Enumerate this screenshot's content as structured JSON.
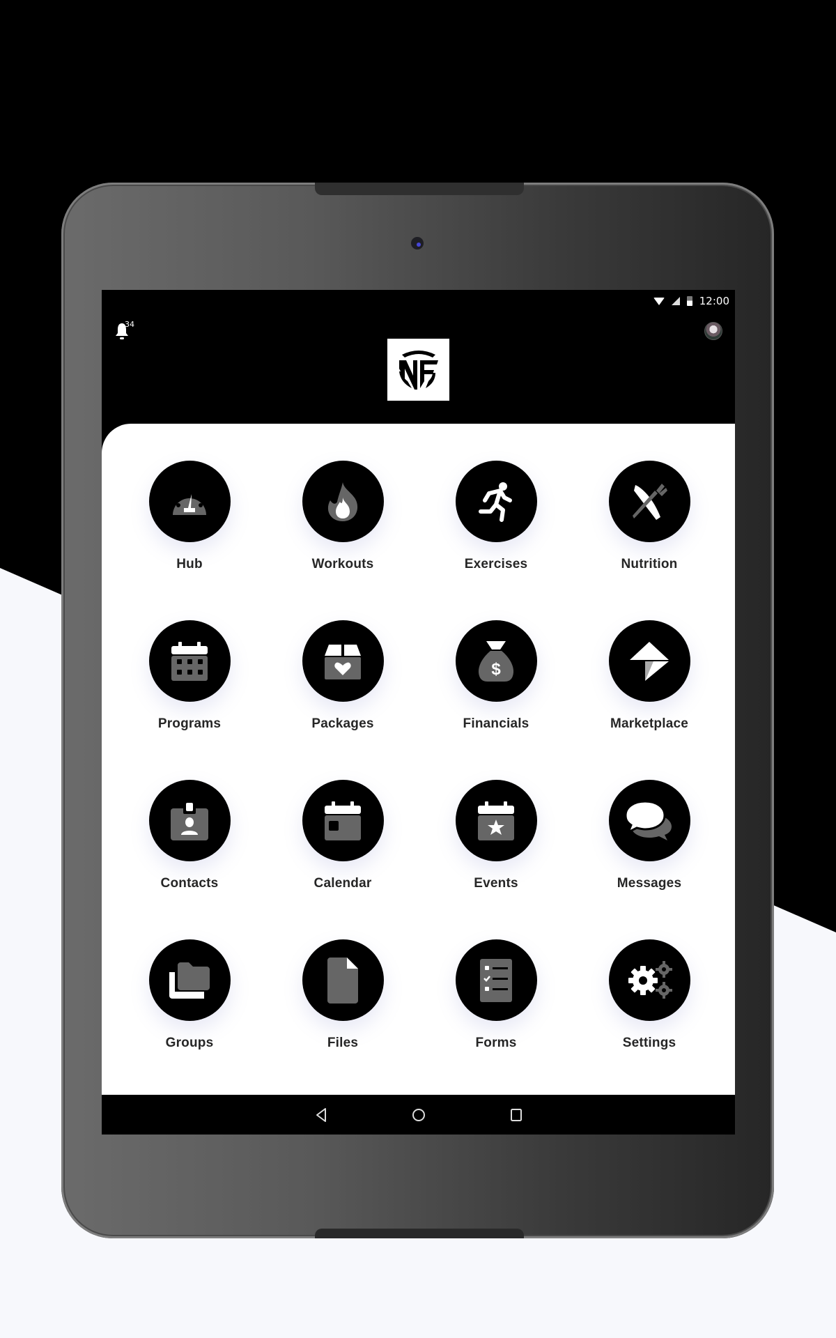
{
  "status_bar": {
    "time": "12:00",
    "icons": [
      "wifi-icon",
      "signal-icon",
      "battery-icon"
    ]
  },
  "header": {
    "notifications_count": "34",
    "logo_text": "NF",
    "avatar": "user-avatar"
  },
  "menu": {
    "items": [
      {
        "label": "Hub",
        "icon": "dashboard-gauge-icon"
      },
      {
        "label": "Workouts",
        "icon": "flame-icon"
      },
      {
        "label": "Exercises",
        "icon": "running-person-icon"
      },
      {
        "label": "Nutrition",
        "icon": "fork-knife-icon"
      },
      {
        "label": "Programs",
        "icon": "calendar-grid-icon"
      },
      {
        "label": "Packages",
        "icon": "box-heart-icon"
      },
      {
        "label": "Financials",
        "icon": "money-bag-icon"
      },
      {
        "label": "Marketplace",
        "icon": "marketplace-arrow-icon"
      },
      {
        "label": "Contacts",
        "icon": "contact-badge-icon"
      },
      {
        "label": "Calendar",
        "icon": "calendar-icon"
      },
      {
        "label": "Events",
        "icon": "calendar-star-icon"
      },
      {
        "label": "Messages",
        "icon": "chat-bubbles-icon"
      },
      {
        "label": "Groups",
        "icon": "folders-icon"
      },
      {
        "label": "Files",
        "icon": "file-icon"
      },
      {
        "label": "Forms",
        "icon": "checklist-icon"
      },
      {
        "label": "Settings",
        "icon": "gears-icon"
      }
    ]
  },
  "nav_bar": {
    "buttons": [
      "back",
      "home",
      "recents"
    ]
  },
  "colors": {
    "icon_circle": "#000000",
    "icon_primary": "#ffffff",
    "icon_secondary": "#666666",
    "label": "#262626",
    "panel": "#ffffff",
    "page_background": "#f7f8fc"
  }
}
